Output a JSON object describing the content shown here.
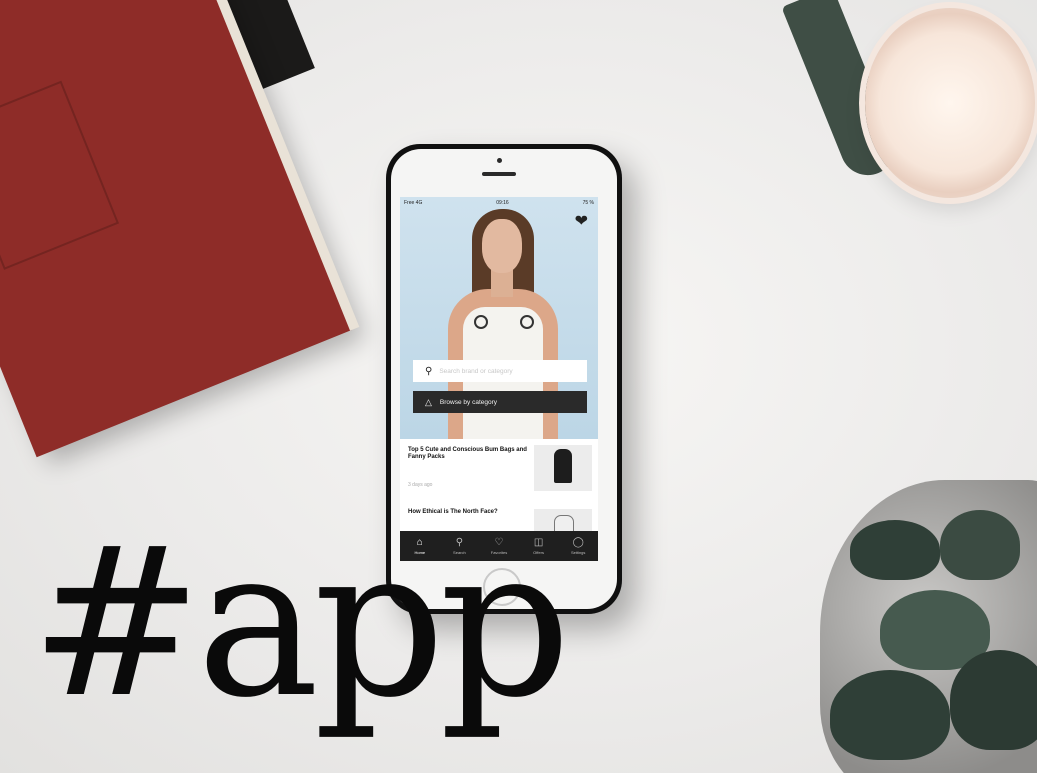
{
  "phone": {
    "status_bar": {
      "carrier": "Free 4G",
      "time": "09:16",
      "battery": "75 %"
    },
    "search": {
      "placeholder": "Search brand or category"
    },
    "browse_button": {
      "label": "Browse by category"
    },
    "articles": [
      {
        "title": "Top 5 Cute and Conscious Bum Bags and Fanny Packs",
        "time": "3 days ago"
      },
      {
        "title": "How Ethical is The North Face?"
      }
    ],
    "tabs": [
      {
        "label": "Home",
        "icon": "home-icon"
      },
      {
        "label": "Search",
        "icon": "search-icon"
      },
      {
        "label": "Favorites",
        "icon": "heart-icon"
      },
      {
        "label": "Offers",
        "icon": "gift-icon"
      },
      {
        "label": "Settings",
        "icon": "user-icon"
      }
    ]
  },
  "overlay": {
    "hashtag": "#app"
  }
}
